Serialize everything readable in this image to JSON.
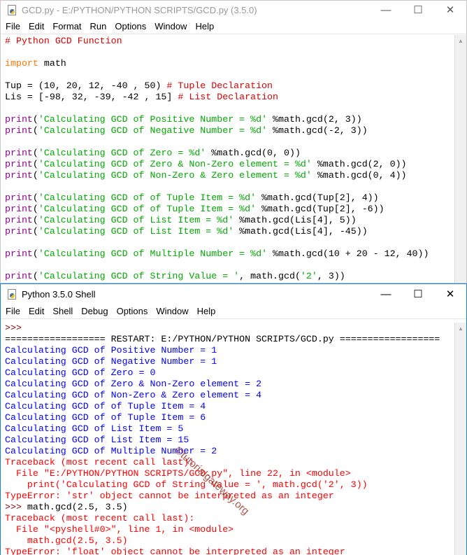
{
  "editor": {
    "title": "GCD.py - E:/PYTHON/PYTHON SCRIPTS/GCD.py (3.5.0)",
    "menu": [
      "File",
      "Edit",
      "Format",
      "Run",
      "Options",
      "Window",
      "Help"
    ],
    "lines": [
      [
        [
          "com",
          "# Python GCD Function"
        ]
      ],
      [],
      [
        [
          "kw",
          "import"
        ],
        [
          "plain",
          " math"
        ]
      ],
      [],
      [
        [
          "plain",
          "Tup = (10, 20, 12, -40 , 50) "
        ],
        [
          "com",
          "# Tuple Declaration"
        ]
      ],
      [
        [
          "plain",
          "Lis = [-98, 32, -39, -42 , 15] "
        ],
        [
          "com",
          "# List Declaration"
        ]
      ],
      [],
      [
        [
          "bi",
          "print"
        ],
        [
          "plain",
          "("
        ],
        [
          "str",
          "'Calculating GCD of Positive Number = %d'"
        ],
        [
          "plain",
          " %math.gcd(2, 3))"
        ]
      ],
      [
        [
          "bi",
          "print"
        ],
        [
          "plain",
          "("
        ],
        [
          "str",
          "'Calculating GCD of Negative Number = %d'"
        ],
        [
          "plain",
          " %math.gcd(-2, 3))"
        ]
      ],
      [],
      [
        [
          "bi",
          "print"
        ],
        [
          "plain",
          "("
        ],
        [
          "str",
          "'Calculating GCD of Zero = %d'"
        ],
        [
          "plain",
          " %math.gcd(0, 0))"
        ]
      ],
      [
        [
          "bi",
          "print"
        ],
        [
          "plain",
          "("
        ],
        [
          "str",
          "'Calculating GCD of Zero & Non-Zero element = %d'"
        ],
        [
          "plain",
          " %math.gcd(2, 0))"
        ]
      ],
      [
        [
          "bi",
          "print"
        ],
        [
          "plain",
          "("
        ],
        [
          "str",
          "'Calculating GCD of Non-Zero & Zero element = %d'"
        ],
        [
          "plain",
          " %math.gcd(0, 4))"
        ]
      ],
      [],
      [
        [
          "bi",
          "print"
        ],
        [
          "plain",
          "("
        ],
        [
          "str",
          "'Calculating GCD of of Tuple Item = %d'"
        ],
        [
          "plain",
          " %math.gcd(Tup[2], 4))"
        ]
      ],
      [
        [
          "bi",
          "print"
        ],
        [
          "plain",
          "("
        ],
        [
          "str",
          "'Calculating GCD of of Tuple Item = %d'"
        ],
        [
          "plain",
          " %math.gcd(Tup[2], -6))"
        ]
      ],
      [
        [
          "bi",
          "print"
        ],
        [
          "plain",
          "("
        ],
        [
          "str",
          "'Calculating GCD of List Item = %d'"
        ],
        [
          "plain",
          " %math.gcd(Lis[4], 5))"
        ]
      ],
      [
        [
          "bi",
          "print"
        ],
        [
          "plain",
          "("
        ],
        [
          "str",
          "'Calculating GCD of List Item = %d'"
        ],
        [
          "plain",
          " %math.gcd(Lis[4], -45))"
        ]
      ],
      [],
      [
        [
          "bi",
          "print"
        ],
        [
          "plain",
          "("
        ],
        [
          "str",
          "'Calculating GCD of Multiple Number = %d'"
        ],
        [
          "plain",
          " %math.gcd(10 + 20 - 12, 40))"
        ]
      ],
      [],
      [
        [
          "bi",
          "print"
        ],
        [
          "plain",
          "("
        ],
        [
          "str",
          "'Calculating GCD of String Value = '"
        ],
        [
          "plain",
          ", math.gcd("
        ],
        [
          "str",
          "'2'"
        ],
        [
          "plain",
          ", 3))"
        ]
      ]
    ]
  },
  "shell": {
    "title": "Python 3.5.0 Shell",
    "menu": [
      "File",
      "Edit",
      "Shell",
      "Debug",
      "Options",
      "Window",
      "Help"
    ],
    "lines": [
      [
        [
          "prompt",
          ">>>"
        ]
      ],
      [
        [
          "plain",
          "================== RESTART: E:/PYTHON/PYTHON SCRIPTS/GCD.py =================="
        ]
      ],
      [
        [
          "out",
          "Calculating GCD of Positive Number = 1"
        ]
      ],
      [
        [
          "out",
          "Calculating GCD of Negative Number = 1"
        ]
      ],
      [
        [
          "out",
          "Calculating GCD of Zero = 0"
        ]
      ],
      [
        [
          "out",
          "Calculating GCD of Zero & Non-Zero element = 2"
        ]
      ],
      [
        [
          "out",
          "Calculating GCD of Non-Zero & Zero element = 4"
        ]
      ],
      [
        [
          "out",
          "Calculating GCD of of Tuple Item = 4"
        ]
      ],
      [
        [
          "out",
          "Calculating GCD of of Tuple Item = 6"
        ]
      ],
      [
        [
          "out",
          "Calculating GCD of List Item = 5"
        ]
      ],
      [
        [
          "out",
          "Calculating GCD of List Item = 15"
        ]
      ],
      [
        [
          "out",
          "Calculating GCD of Multiple Number = 2"
        ]
      ],
      [
        [
          "err",
          "Traceback (most recent call last):"
        ]
      ],
      [
        [
          "err",
          "  File \"E:/PYTHON/PYTHON SCRIPTS/GCD.py\", line 22, in <module>"
        ]
      ],
      [
        [
          "err",
          "    print('Calculating GCD of String Value = ', math.gcd('2', 3))"
        ]
      ],
      [
        [
          "err",
          "TypeError: 'str' object cannot be interpreted as an integer"
        ]
      ],
      [
        [
          "prompt",
          ">>> "
        ],
        [
          "plain",
          "math.gcd(2.5, 3.5)"
        ]
      ],
      [
        [
          "err",
          "Traceback (most recent call last):"
        ]
      ],
      [
        [
          "err",
          "  File \"<pyshell#0>\", line 1, in <module>"
        ]
      ],
      [
        [
          "err",
          "    math.gcd(2.5, 3.5)"
        ]
      ],
      [
        [
          "err",
          "TypeError: 'float' object cannot be interpreted as an integer"
        ]
      ],
      [
        [
          "plain",
          "|"
        ]
      ]
    ]
  },
  "window_controls": {
    "minimize": "—",
    "maximize": "☐",
    "close": "✕"
  },
  "watermark": "©tutorialgateway.org"
}
